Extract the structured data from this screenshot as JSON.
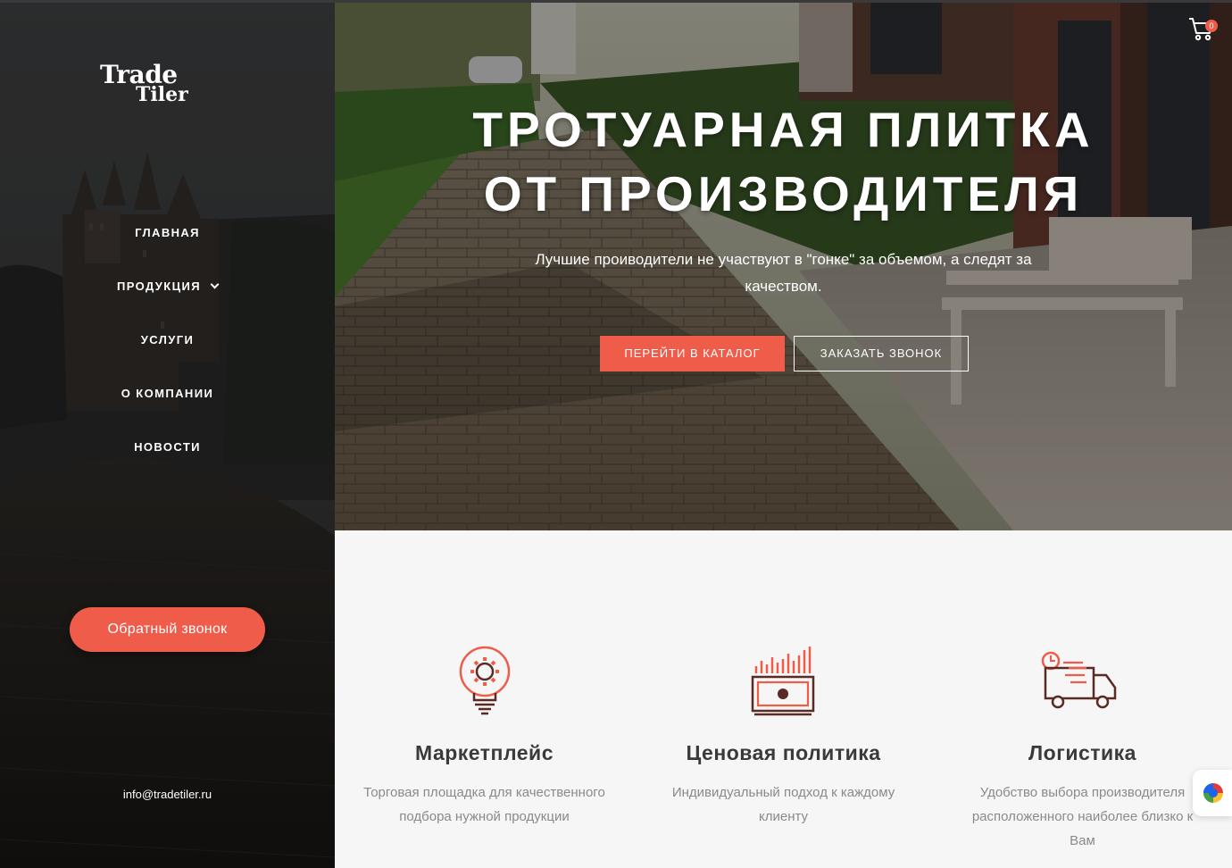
{
  "brand": {
    "line1": "Trade",
    "line2": "Tiler"
  },
  "nav": {
    "items": [
      {
        "label": "ГЛАВНАЯ"
      },
      {
        "label": "ПРОДУКЦИЯ",
        "has_dropdown": true
      },
      {
        "label": "УСЛУГИ"
      },
      {
        "label": "О КОМПАНИИ"
      },
      {
        "label": "НОВОСТИ"
      }
    ]
  },
  "sidebar": {
    "callback_label": "Обратный звонок",
    "email": "info@tradetiler.ru"
  },
  "hero": {
    "title_line1": "ТРОТУАРНАЯ ПЛИТКА",
    "title_line2": "ОТ ПРОИЗВОДИТЕЛЯ",
    "subtitle": "Лучшие проиводители не участвуют в \"гонке\" за объемом, а следят за качеством.",
    "catalog_button": "ПЕРЕЙТИ В КАТАЛОГ",
    "call_button": "ЗАКАЗАТЬ ЗВОНОК"
  },
  "cart": {
    "count": "0",
    "icon": "cart-icon"
  },
  "features": [
    {
      "icon": "lightbulb-gear-icon",
      "title": "Маркетплейс",
      "text": "Торговая площадка для качественного подбора нужной продукции"
    },
    {
      "icon": "money-chart-icon",
      "title": "Ценовая политика",
      "text": "Индивидуальный подход к каждому клиенту"
    },
    {
      "icon": "delivery-truck-icon",
      "title": "Логистика",
      "text": "Удобство выбора производителя расположенного наиболее близко к Вам"
    }
  ],
  "colors": {
    "accent": "#ef5c4a",
    "icon_dark": "#5a2a24",
    "sidebar_bg": "#262626"
  }
}
